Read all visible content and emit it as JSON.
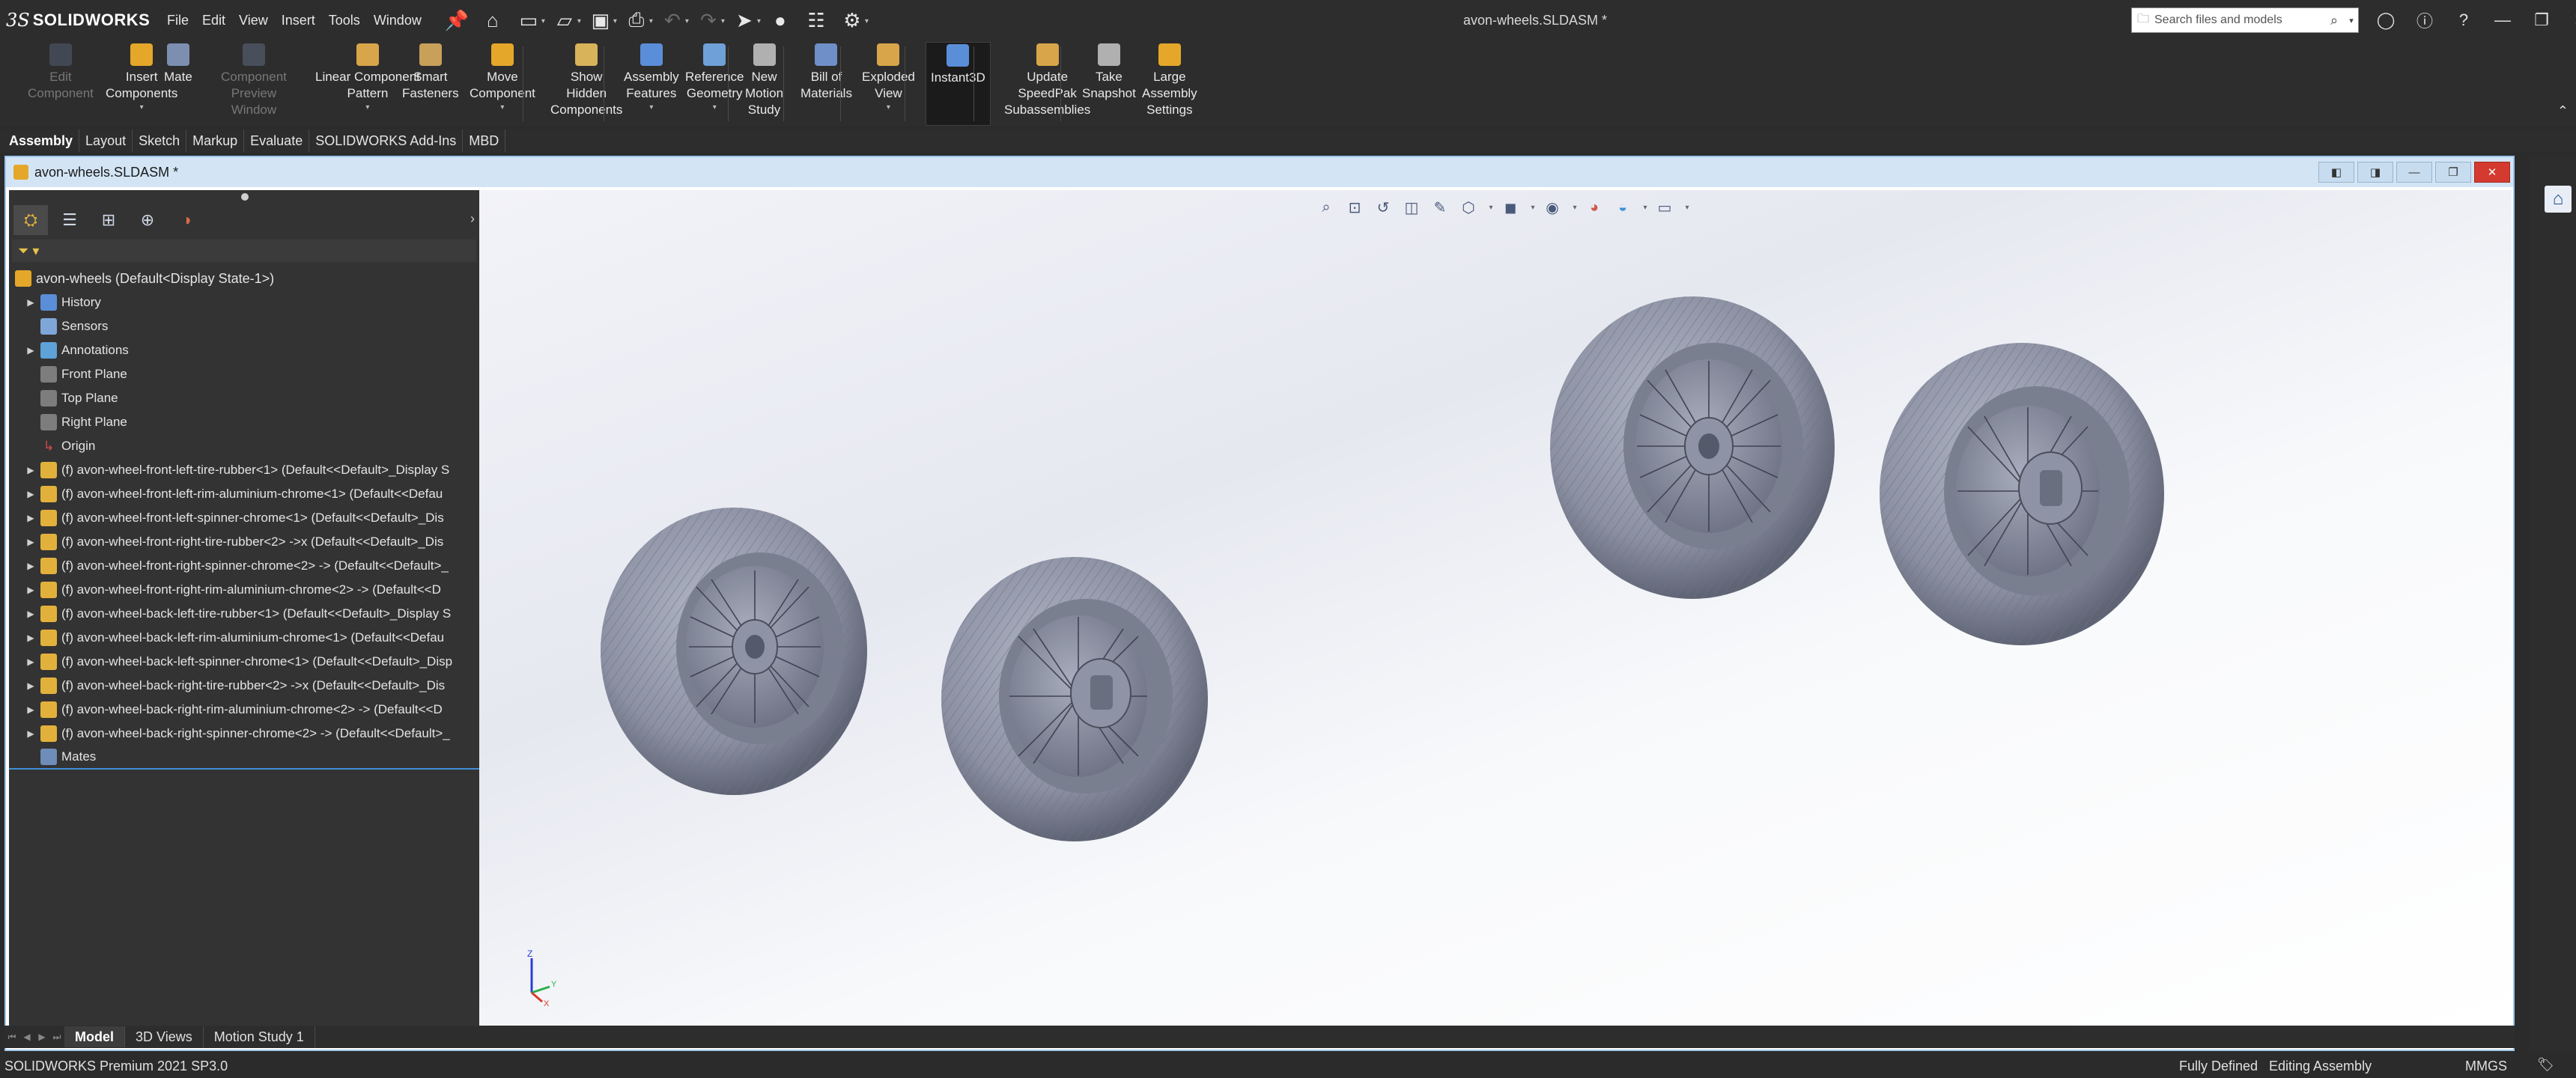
{
  "app": {
    "brand": "SOLIDWORKS",
    "ds_mark": "3S"
  },
  "menu": [
    "File",
    "Edit",
    "View",
    "Insert",
    "Tools",
    "Window"
  ],
  "quick_access_icons": [
    "pin-icon",
    "home-icon",
    "new-document-icon",
    "open-icon",
    "save-icon",
    "print-icon",
    "undo-icon",
    "redo-icon",
    "select-icon",
    "rebuild-icon",
    "file-properties-icon",
    "options-icon"
  ],
  "document_title": "avon-wheels.SLDASM *",
  "search": {
    "placeholder": "Search files and models"
  },
  "window_controls": [
    "account-icon",
    "help-icon",
    "question-icon",
    "minimize-icon",
    "restore-icon",
    "close-icon"
  ],
  "commands": [
    {
      "lines": [
        "Edit",
        "Component"
      ],
      "enabled": false,
      "icon": "edit-component-icon",
      "color": "#6a7a9a",
      "dropdown": false
    },
    {
      "lines": [
        "Insert",
        "Components"
      ],
      "enabled": true,
      "icon": "insert-components-icon",
      "color": "#e4a72a",
      "dropdown": true
    },
    {
      "lines": [
        "Mate"
      ],
      "enabled": true,
      "icon": "mate-icon",
      "color": "#7c8fb0",
      "dropdown": false
    },
    {
      "lines": [
        "Component",
        "Preview",
        "Window"
      ],
      "enabled": false,
      "icon": "component-preview-icon",
      "color": "#7c8fb0",
      "dropdown": false
    },
    {
      "lines": [
        "Linear Component",
        "Pattern"
      ],
      "enabled": true,
      "icon": "linear-pattern-icon",
      "color": "#d8a54a",
      "dropdown": true
    },
    {
      "lines": [
        "Smart",
        "Fasteners"
      ],
      "enabled": true,
      "icon": "smart-fasteners-icon",
      "color": "#c8a05a",
      "dropdown": false
    },
    {
      "lines": [
        "Move",
        "Component"
      ],
      "enabled": true,
      "icon": "move-component-icon",
      "color": "#e4a72a",
      "dropdown": true
    },
    {
      "lines": [
        "Show",
        "Hidden",
        "Components"
      ],
      "enabled": true,
      "icon": "show-hidden-icon",
      "color": "#d8b35a",
      "dropdown": false
    },
    {
      "lines": [
        "Assembly",
        "Features"
      ],
      "enabled": true,
      "icon": "assembly-features-icon",
      "color": "#5b8ed8",
      "dropdown": true
    },
    {
      "lines": [
        "Reference",
        "Geometry"
      ],
      "enabled": true,
      "icon": "reference-geometry-icon",
      "color": "#6fa0d8",
      "dropdown": true
    },
    {
      "lines": [
        "New",
        "Motion",
        "Study"
      ],
      "enabled": true,
      "icon": "motion-study-icon",
      "color": "#b0b0b0",
      "dropdown": false
    },
    {
      "lines": [
        "Bill of",
        "Materials"
      ],
      "enabled": true,
      "icon": "bom-icon",
      "color": "#6f8fc8",
      "dropdown": false
    },
    {
      "lines": [
        "Exploded",
        "View"
      ],
      "enabled": true,
      "icon": "exploded-view-icon",
      "color": "#d8a54a",
      "dropdown": true
    },
    {
      "lines": [
        "Instant3D"
      ],
      "enabled": true,
      "icon": "instant3d-icon",
      "color": "#5b8ed8",
      "dropdown": false
    },
    {
      "lines": [
        "Update",
        "SpeedPak",
        "Subassemblies"
      ],
      "enabled": true,
      "icon": "speedpak-icon",
      "color": "#d8a54a",
      "dropdown": false
    },
    {
      "lines": [
        "Take",
        "Snapshot"
      ],
      "enabled": true,
      "icon": "snapshot-icon",
      "color": "#b0b0b0",
      "dropdown": false
    },
    {
      "lines": [
        "Large",
        "Assembly",
        "Settings"
      ],
      "enabled": true,
      "icon": "large-assembly-icon",
      "color": "#e4a72a",
      "dropdown": false
    }
  ],
  "tabs": [
    "Assembly",
    "Layout",
    "Sketch",
    "Markup",
    "Evaluate",
    "SOLIDWORKS Add-Ins",
    "MBD"
  ],
  "active_tab": "Assembly",
  "tree": {
    "root": "avon-wheels  (Default<Display State-1>)",
    "items": [
      {
        "label": "History",
        "icon": "history-icon",
        "kind": "hist",
        "expandable": true
      },
      {
        "label": "Sensors",
        "icon": "sensors-icon",
        "kind": "sens",
        "expandable": false
      },
      {
        "label": "Annotations",
        "icon": "annotations-icon",
        "kind": "annot",
        "expandable": true
      },
      {
        "label": "Front Plane",
        "icon": "plane-icon",
        "kind": "plane",
        "expandable": false
      },
      {
        "label": "Top Plane",
        "icon": "plane-icon",
        "kind": "plane",
        "expandable": false
      },
      {
        "label": "Right Plane",
        "icon": "plane-icon",
        "kind": "plane",
        "expandable": false
      },
      {
        "label": "Origin",
        "icon": "origin-icon",
        "kind": "origin",
        "expandable": false
      },
      {
        "label": "(f) avon-wheel-front-left-tire-rubber<1> (Default<<Default>_Display S",
        "icon": "part-icon",
        "kind": "part",
        "expandable": true
      },
      {
        "label": "(f) avon-wheel-front-left-rim-aluminium-chrome<1> (Default<<Defau",
        "icon": "part-icon",
        "kind": "part",
        "expandable": true
      },
      {
        "label": "(f) avon-wheel-front-left-spinner-chrome<1> (Default<<Default>_Dis",
        "icon": "part-icon",
        "kind": "part",
        "expandable": true
      },
      {
        "label": "(f) avon-wheel-front-right-tire-rubber<2> ->x (Default<<Default>_Dis",
        "icon": "part-icon",
        "kind": "part",
        "expandable": true
      },
      {
        "label": "(f) avon-wheel-front-right-spinner-chrome<2> -> (Default<<Default>_",
        "icon": "part-icon",
        "kind": "part",
        "expandable": true
      },
      {
        "label": "(f) avon-wheel-front-right-rim-aluminium-chrome<2> -> (Default<<D",
        "icon": "part-icon",
        "kind": "part",
        "expandable": true
      },
      {
        "label": "(f) avon-wheel-back-left-tire-rubber<1> (Default<<Default>_Display S",
        "icon": "part-icon",
        "kind": "part",
        "expandable": true
      },
      {
        "label": "(f) avon-wheel-back-left-rim-aluminium-chrome<1> (Default<<Defau",
        "icon": "part-icon",
        "kind": "part",
        "expandable": true
      },
      {
        "label": "(f) avon-wheel-back-left-spinner-chrome<1> (Default<<Default>_Disp",
        "icon": "part-icon",
        "kind": "part",
        "expandable": true
      },
      {
        "label": "(f) avon-wheel-back-right-tire-rubber<2> ->x (Default<<Default>_Dis",
        "icon": "part-icon",
        "kind": "part",
        "expandable": true
      },
      {
        "label": "(f) avon-wheel-back-right-rim-aluminium-chrome<2> -> (Default<<D",
        "icon": "part-icon",
        "kind": "part",
        "expandable": true
      },
      {
        "label": "(f) avon-wheel-back-right-spinner-chrome<2> -> (Default<<Default>_",
        "icon": "part-icon",
        "kind": "part",
        "expandable": true
      },
      {
        "label": "Mates",
        "icon": "mates-icon",
        "kind": "mates",
        "expandable": false
      }
    ]
  },
  "bottom_tabs": [
    "Model",
    "3D Views",
    "Motion Study 1"
  ],
  "active_bottom_tab": "Model",
  "triad": {
    "z": "Z",
    "x": "X",
    "y": "Y"
  },
  "status": {
    "product": "SOLIDWORKS Premium 2021 SP3.0",
    "definition": "Fully Defined",
    "mode": "Editing Assembly",
    "units": "MMGS"
  },
  "colors": {
    "accent": "#9cc7ec",
    "ui_bg": "#2d2d2d",
    "tire": "#8e93a4",
    "part_icon": "#e2b13c",
    "close": "#d43a2f"
  }
}
